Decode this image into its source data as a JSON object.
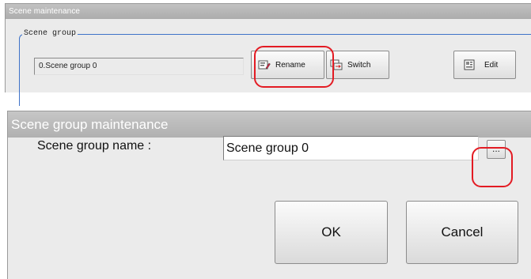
{
  "scene_maintenance": {
    "title": "Scene maintenance",
    "group_legend": "Scene group",
    "current_group": "0.Scene group 0",
    "buttons": {
      "rename": {
        "label": "Rename",
        "icon": "rename-icon"
      },
      "switch": {
        "label": "Switch",
        "icon": "switch-icon"
      },
      "edit": {
        "label": "Edit",
        "icon": "edit-icon"
      }
    }
  },
  "scene_group_maintenance": {
    "title": "Scene group maintenance",
    "name_label": "Scene group name :",
    "name_value": "Scene group 0",
    "ellipsis_label": "...",
    "ok_label": "OK",
    "cancel_label": "Cancel"
  },
  "colors": {
    "highlight": "#e31b23",
    "group_frame": "#3e72c8",
    "panel_bg": "#ebebeb"
  }
}
